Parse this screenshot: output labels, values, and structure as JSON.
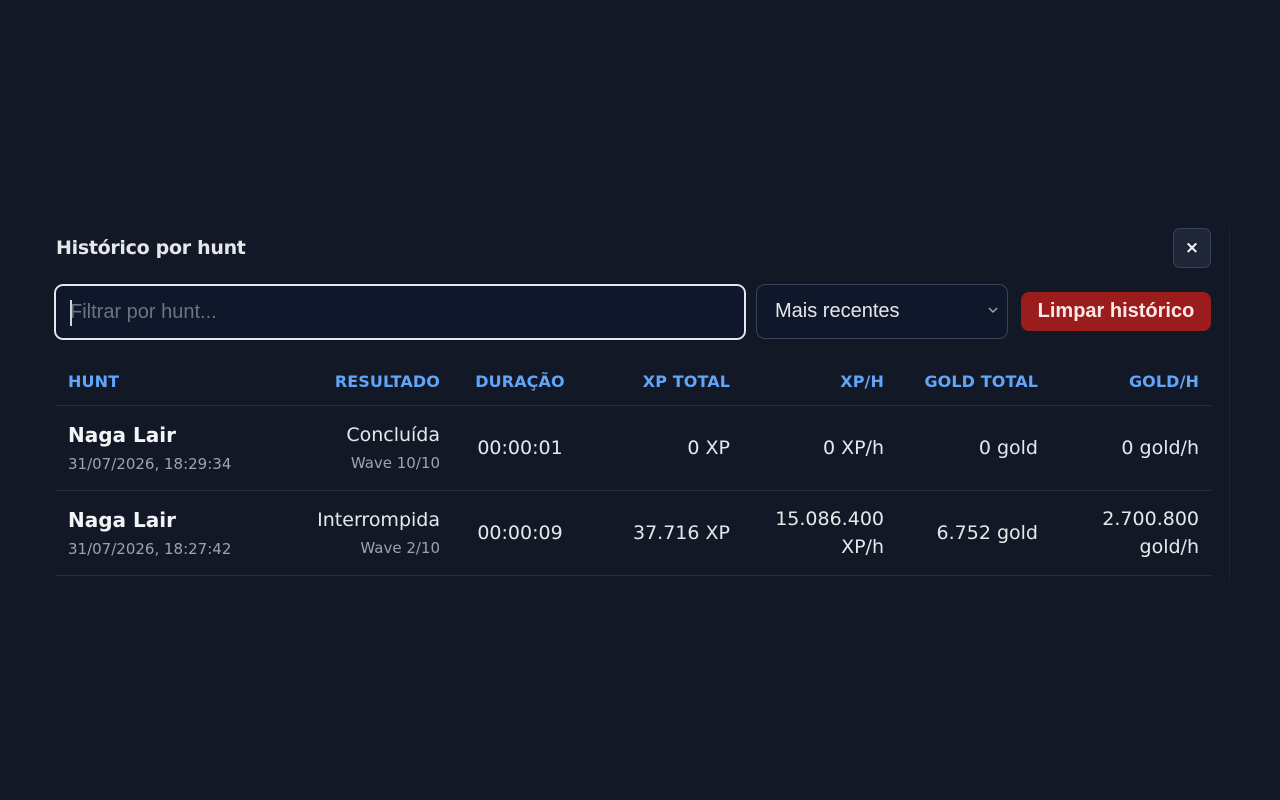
{
  "panel": {
    "title": "Histórico por hunt",
    "close_label": "×"
  },
  "controls": {
    "filter_placeholder": "Filtrar por hunt...",
    "filter_value": "",
    "sort_selected": "Mais recentes",
    "clear_label": "Limpar histórico"
  },
  "table": {
    "headers": {
      "hunt": "HUNT",
      "resultado": "RESULTADO",
      "duracao": "DURAÇÃO",
      "xp_total": "XP TOTAL",
      "xp_h": "XP/H",
      "gold_total": "GOLD TOTAL",
      "gold_h": "GOLD/H"
    },
    "rows": [
      {
        "hunt": "Naga Lair",
        "date": "31/07/2026, 18:29:34",
        "result": "Concluída",
        "wave": "Wave 10/10",
        "duration": "00:00:01",
        "xp_total": "0 XP",
        "xp_h_value": "0",
        "xp_h_unit": "XP/h",
        "gold_total": "0 gold",
        "gold_h_value": "0",
        "gold_h_unit": "gold/h"
      },
      {
        "hunt": "Naga Lair",
        "date": "31/07/2026, 18:27:42",
        "result": "Interrompida",
        "wave": "Wave 2/10",
        "duration": "00:00:09",
        "xp_total": "37.716 XP",
        "xp_h_value": "15.086.400",
        "xp_h_unit": "XP/h",
        "gold_total": "6.752 gold",
        "gold_h_value": "2.700.800",
        "gold_h_unit": "gold/h"
      }
    ]
  }
}
